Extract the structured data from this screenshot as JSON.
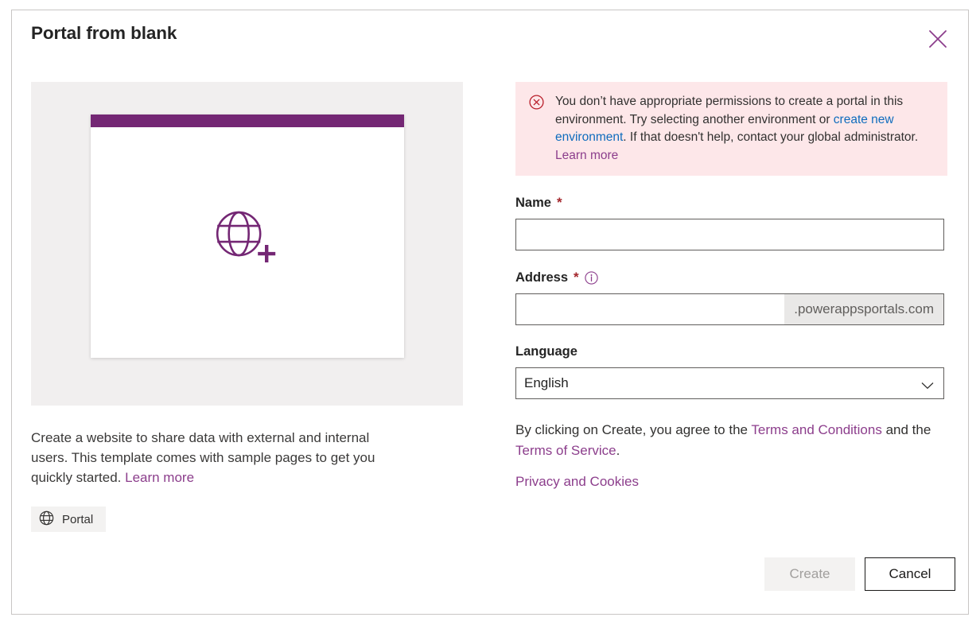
{
  "dialog": {
    "title": "Portal from blank",
    "close_icon": "close-icon"
  },
  "preview": {
    "icon": "globe-plus-icon",
    "topbar_color": "#742774"
  },
  "description": {
    "text_before_link": "Create a website to share data with external and internal users. This template comes with sample pages to get you quickly started. ",
    "learn_more": "Learn more"
  },
  "tag": {
    "icon": "globe-icon",
    "label": "Portal"
  },
  "error": {
    "icon": "error-circle-x-icon",
    "part1": "You don’t have appropriate permissions to create a portal in this environment. Try selecting another environment or ",
    "link_create_env": "create new environment",
    "part2": ". If that doesn't help, contact your global administrator. ",
    "learn_more": "Learn more",
    "background": "#fde7e9",
    "link_color": "#0f6cbd"
  },
  "form": {
    "name": {
      "label": "Name",
      "required_marker": "*",
      "value": "",
      "placeholder": ""
    },
    "address": {
      "label": "Address",
      "required_marker": "*",
      "info_icon": "info-icon",
      "value": "",
      "placeholder": "",
      "suffix": ".powerappsportals.com"
    },
    "language": {
      "label": "Language",
      "selected": "English",
      "chevron_icon": "chevron-down-icon"
    }
  },
  "terms": {
    "part1": "By clicking on Create, you agree to the ",
    "link_terms_conditions": "Terms and Conditions",
    "part2": " and the ",
    "link_terms_service": "Terms of Service",
    "part3": ".",
    "privacy_link": "Privacy and Cookies"
  },
  "footer": {
    "create_label": "Create",
    "cancel_label": "Cancel"
  },
  "colors": {
    "brand_purple": "#742774",
    "link_purple": "#8c3e8c",
    "error_red": "#a4262c",
    "link_blue": "#0f6cbd"
  }
}
